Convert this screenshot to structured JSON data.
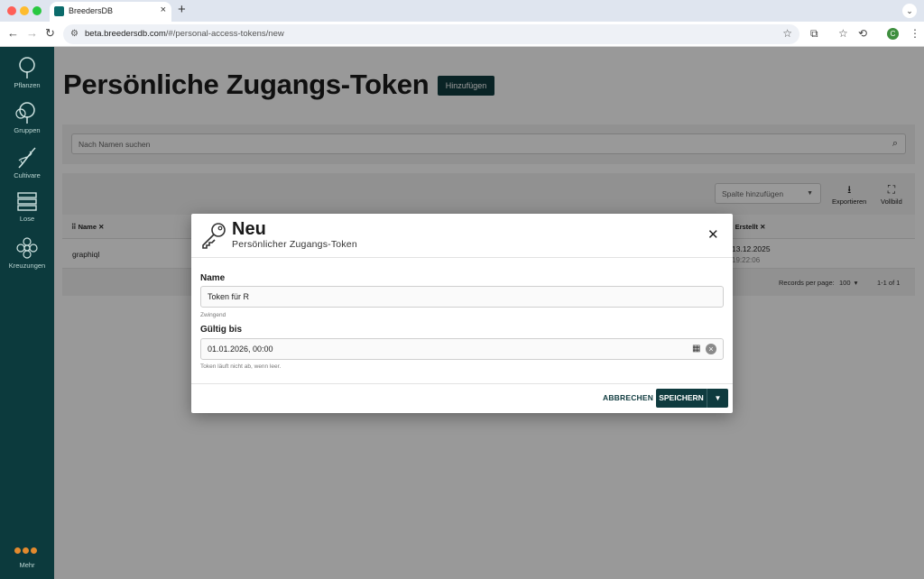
{
  "browser": {
    "tab_title": "BreedersDB",
    "url_host": "beta.breedersdb.com",
    "url_path": "/#/personal-access-tokens/new",
    "new_tab": "+",
    "profile_initial": "C",
    "colors": {
      "close": "#ff5f57",
      "minimize": "#febc2e",
      "maximize": "#28c840"
    }
  },
  "sidebar": {
    "items": [
      {
        "label": "Pflanzen",
        "icon": "tree-icon"
      },
      {
        "label": "Gruppen",
        "icon": "trees-icon"
      },
      {
        "label": "Cultivare",
        "icon": "dna-icon"
      },
      {
        "label": "Lose",
        "icon": "batches-icon"
      },
      {
        "label": "Kreuzungen",
        "icon": "flower-icon"
      }
    ],
    "more_label": "Mehr"
  },
  "page": {
    "title": "Persönliche Zugangs-Token",
    "add_button": "Hinzufügen",
    "search_placeholder": "Nach Namen suchen",
    "column_select_placeholder": "Spalte hinzufügen",
    "export_label": "Exportieren",
    "fullscreen_label": "Vollbild",
    "columns": {
      "name": "Name",
      "created": "Erstellt"
    },
    "rows": [
      {
        "name": "graphiql",
        "created_date": "13.12.2025",
        "created_time": "19:22:06"
      }
    ],
    "records_per_page_label": "Records per page:",
    "records_per_page": "100",
    "range": "1-1 of 1"
  },
  "modal": {
    "title": "Neu",
    "subtitle": "Persönlicher Zugangs-Token",
    "name_label": "Name",
    "name_value": "Token für R",
    "name_hint": "Zwingend",
    "valid_label": "Gültig bis",
    "valid_value": "01.01.2026, 00:00",
    "valid_hint": "Token läuft nicht ab, wenn leer.",
    "cancel": "ABBRECHEN",
    "save": "SPEICHERN"
  },
  "colors": {
    "primary": "#0f3b3f",
    "sidebar": "#0c3a3d",
    "accent": "#e38a2e"
  }
}
